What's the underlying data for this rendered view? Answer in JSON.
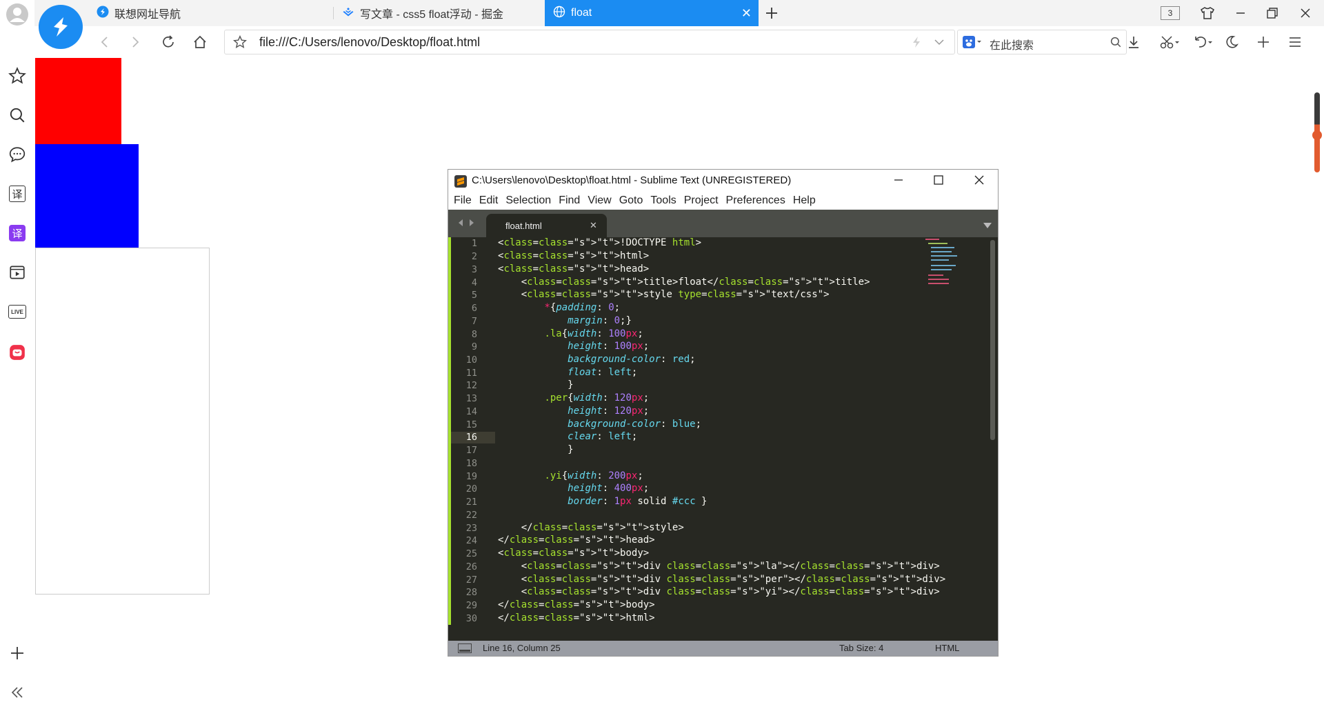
{
  "browser": {
    "tab_count": "3",
    "tabs": [
      {
        "label": "联想网址导航"
      },
      {
        "label": "写文章 - css5 float浮动 - 掘金"
      },
      {
        "label": "float"
      }
    ],
    "url": "file:///C:/Users/lenovo/Desktop/float.html",
    "search_placeholder": "在此搜索",
    "accent": "#1b8cf2"
  },
  "sidebar": {
    "items": [
      "avatar-icon",
      "star-icon",
      "search-icon",
      "chat-icon",
      "translate-icon",
      "translate-purple-icon",
      "video-icon",
      "live-icon",
      "app-icon"
    ],
    "live_label": "LIVE",
    "translate_label": "译"
  },
  "page": {
    "boxes": [
      {
        "class": "la",
        "color": "red"
      },
      {
        "class": "per",
        "color": "blue"
      },
      {
        "class": "yi",
        "border": "#ccc"
      }
    ]
  },
  "sublime": {
    "title": "C:\\Users\\lenovo\\Desktop\\float.html - Sublime Text (UNREGISTERED)",
    "menu": [
      "File",
      "Edit",
      "Selection",
      "Find",
      "View",
      "Goto",
      "Tools",
      "Project",
      "Preferences",
      "Help"
    ],
    "tab": "float.html",
    "status": {
      "position": "Line 16, Column 25",
      "tab_size": "Tab Size: 4",
      "syntax": "HTML"
    },
    "line_numbers": [
      "1",
      "2",
      "3",
      "4",
      "5",
      "6",
      "7",
      "8",
      "9",
      "10",
      "11",
      "12",
      "13",
      "14",
      "15",
      "16",
      "17",
      "18",
      "19",
      "20",
      "21",
      "22",
      "23",
      "24",
      "25",
      "26",
      "27",
      "28",
      "29",
      "30"
    ],
    "code": [
      "<!DOCTYPE html>",
      "<html>",
      "<head>",
      "    <title>float</title>",
      "    <style type=\"text/css\">",
      "        *{padding: 0;",
      "            margin: 0;}",
      "        .la{width: 100px;",
      "            height: 100px;",
      "            background-color: red;",
      "            float: left;",
      "            }",
      "        .per{width: 120px;",
      "            height: 120px;",
      "            background-color: blue;",
      "            clear: left;",
      "            }",
      "",
      "        .yi{width: 200px;",
      "            height: 400px;",
      "            border: 1px solid #ccc }",
      "",
      "    </style>",
      "</head>",
      "<body>",
      "    <div class=\"la\"></div>",
      "    <div class=\"per\"></div>",
      "    <div class=\"yi\"></div>",
      "</body>",
      "</html>"
    ]
  }
}
